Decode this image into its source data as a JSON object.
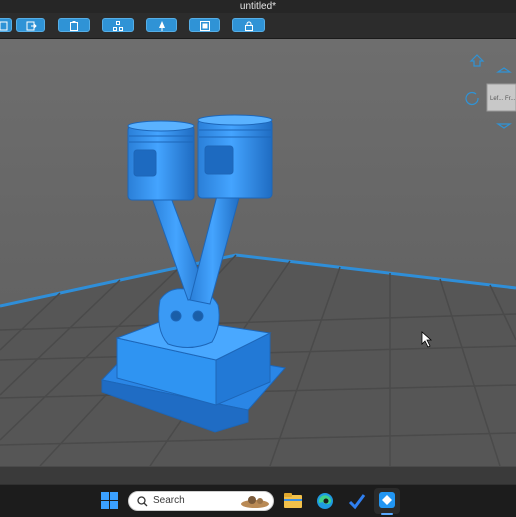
{
  "window": {
    "title": "untitled*"
  },
  "toolbar": {
    "buttons": [
      {
        "name": "import-icon"
      },
      {
        "name": "export-icon"
      },
      {
        "name": "clipboard-icon"
      },
      {
        "name": "arrange-icon"
      },
      {
        "name": "support-icon"
      },
      {
        "name": "frame-icon"
      },
      {
        "name": "lock-icon"
      }
    ],
    "accent": "#2f93d6"
  },
  "viewport": {
    "background": "#6b6b6b",
    "model_color": "#2b8ef0",
    "navcube": {
      "label": "Lef... Fr..."
    }
  },
  "taskbar": {
    "search_placeholder": "Search",
    "apps": [
      "windows-start-icon",
      "file-explorer-icon",
      "edge-browser-icon",
      "tasks-app-icon",
      "slicer-app-icon"
    ]
  }
}
